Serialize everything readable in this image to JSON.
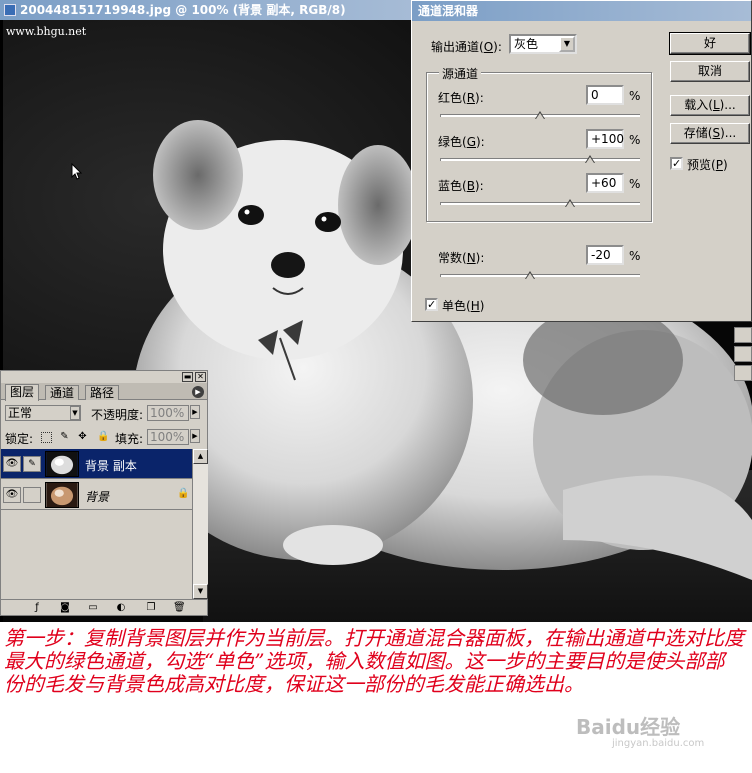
{
  "document": {
    "title": "200448151719948.jpg @ 100% (背景 副本, RGB/8)",
    "watermark": "www.bhgu.net"
  },
  "channel_mixer": {
    "title": "通道混和器",
    "output_channel_label": "输出通道(",
    "output_channel_key": "O",
    "output_channel_value": "灰色",
    "source_group_title": "源通道",
    "red_label": "红色(",
    "red_key": "R",
    "red_value": "0",
    "red_slider": 0,
    "green_label": "绿色(",
    "green_key": "G",
    "green_value": "+100",
    "green_slider": 100,
    "blue_label": "蓝色(",
    "blue_key": "B",
    "blue_value": "+60",
    "blue_slider": 60,
    "constant_label": "常数(",
    "constant_key": "N",
    "constant_value": "-20",
    "constant_slider": -20,
    "percent": "%",
    "close_paren": "):",
    "monochrome_label": "单色(",
    "monochrome_key": "H",
    "monochrome_checked": true,
    "preview_label": "预览(",
    "preview_key": "P",
    "preview_checked": true,
    "ok_label": "好",
    "cancel_label": "取消",
    "load_label": "载入(",
    "load_key": "L",
    "save_label": "存储(",
    "save_key": "S",
    "ellipsis": ")..."
  },
  "layers_panel": {
    "tabs": [
      "图层",
      "通道",
      "路径"
    ],
    "blend_mode": "正常",
    "opacity_label": "不透明度:",
    "opacity_value": "100%",
    "lock_label": "锁定:",
    "fill_label": "填充:",
    "fill_value": "100%",
    "layers": [
      {
        "name": "背景 副本",
        "selected": true
      },
      {
        "name": "背景",
        "selected": false,
        "locked": true
      }
    ]
  },
  "caption": "第一步：复制背景图层并作为当前层。打开通道混合器面板，在输出通道中选对比度最大的绿色通道，勾选“单色”选项，输入数值如图。这一步的主要目的是使头部部份的毛发与背景色成高对比度，保证这一部份的毛发能正确选出。",
  "watermark_brand": "Baidu经验",
  "watermark_url": "jingyan.baidu.com"
}
